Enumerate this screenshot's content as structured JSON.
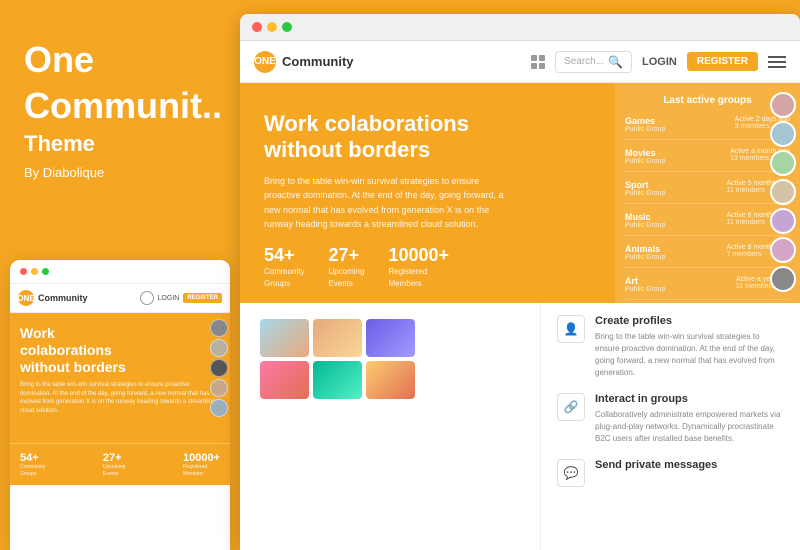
{
  "leftPanel": {
    "brand": {
      "title": "One",
      "subtitle": "Communit..",
      "section": "Theme",
      "by": "By Diabolique"
    }
  },
  "mobileNav": {
    "logoText": "ONE",
    "communityLabel": "Community",
    "loginLabel": "LOGIN",
    "registerLabel": "REGISTER"
  },
  "mobileHero": {
    "title": "Work colaborations without borders",
    "description": "Bring to the table win-win survival strategies to ensure proactive domination. At the end of the day, going forward, a new normal that has evolved from generation X is on the runway heading towards a streamlined cloud solution."
  },
  "stats": {
    "groups": {
      "num": "54+",
      "label": "Community\nGroups"
    },
    "events": {
      "num": "27+",
      "label": "Upcoming\nEvents"
    },
    "members": {
      "num": "10000+",
      "label": "Registered\nMembers"
    }
  },
  "browserNav": {
    "logoText": "ONE",
    "communityLabel": "Community",
    "searchPlaceholder": "Search...",
    "loginLabel": "LOGIN",
    "registerLabel": "REGISTER"
  },
  "hero": {
    "title": "Work colaborations without borders",
    "description": "Bring to the table win-win survival strategies to ensure proactive domination. At the end of the day, going forward, a new normal that has evolved from generation X is on the runway heading towards a streamlined cloud solution."
  },
  "lastActiveGroups": {
    "title": "Last active groups",
    "groups": [
      {
        "name": "Games",
        "type": "Public Group",
        "activity": "Active 2 days ago",
        "members": "3 members"
      },
      {
        "name": "Movies",
        "type": "Public Group",
        "activity": "Active a month ago",
        "members": "13 members"
      },
      {
        "name": "Sport",
        "type": "Public Group",
        "activity": "Active 5 months ago",
        "members": "11 members"
      },
      {
        "name": "Music",
        "type": "Public Group",
        "activity": "Active 6 months ago",
        "members": "11 members"
      },
      {
        "name": "Animals",
        "type": "Public Group",
        "activity": "Active 8 months ago",
        "members": "7 members"
      },
      {
        "name": "Art",
        "type": "Public Group",
        "activity": "Active a year ago",
        "members": "11 members"
      }
    ]
  },
  "features": [
    {
      "icon": "👤",
      "title": "Create profiles",
      "description": "Bring to the table win-win survival strategies to ensure proactive domination. At the end of the day, going forward, a new normal that has evolved from generation."
    },
    {
      "icon": "🔗",
      "title": "Interact in groups",
      "description": "Collaboratively administrate empowered markets via plug-and-play networks. Dynamically procrastinate B2C users after installed base benefits."
    },
    {
      "icon": "💬",
      "title": "Send private messages",
      "description": ""
    }
  ]
}
